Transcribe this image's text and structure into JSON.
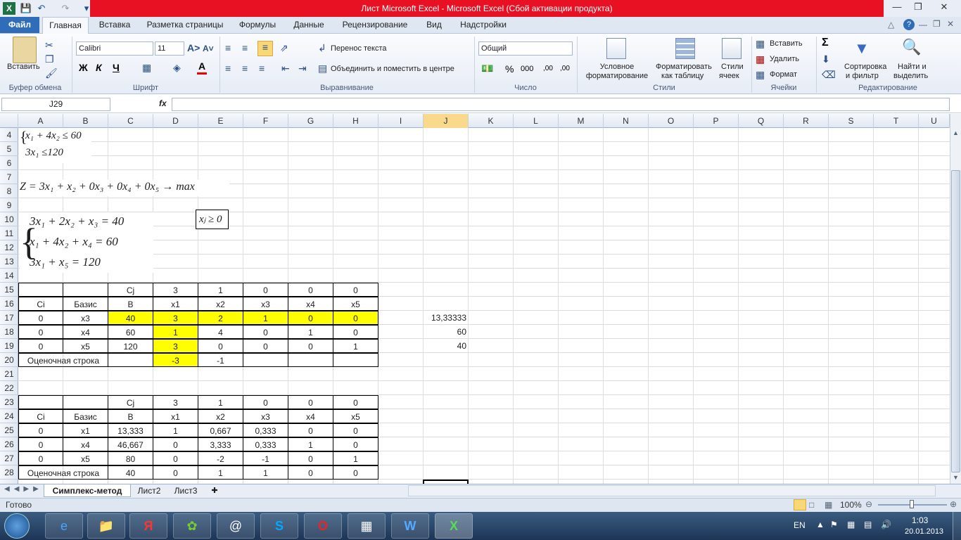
{
  "window": {
    "title": "Лист Microsoft Excel  -  Microsoft Excel (Сбой активации продукта)"
  },
  "tabs": [
    "Файл",
    "Главная",
    "Вставка",
    "Разметка страницы",
    "Формулы",
    "Данные",
    "Рецензирование",
    "Вид",
    "Надстройки"
  ],
  "ribbon": {
    "clipboard": {
      "paste": "Вставить",
      "label": "Буфер обмена"
    },
    "font": {
      "name": "Calibri",
      "size": "11",
      "label": "Шрифт",
      "bold": "Ж",
      "italic": "К",
      "underline": "Ч"
    },
    "alignment": {
      "wrap": "Перенос текста",
      "merge": "Объединить и поместить в центре",
      "label": "Выравнивание"
    },
    "number": {
      "format": "Общий",
      "label": "Число",
      "percent": "%",
      "thousands": "000",
      "inc_decimal": ",00",
      "dec_decimal": ",00"
    },
    "styles": {
      "conditional": "Условное форматирование",
      "conditional_l1": "Условное",
      "conditional_l2": "форматирование",
      "format_table_l1": "Форматировать",
      "format_table_l2": "как таблицу",
      "cell_styles_l1": "Стили",
      "cell_styles_l2": "ячеек",
      "label": "Стили"
    },
    "cells": {
      "insert": "Вставить",
      "delete": "Удалить",
      "format": "Формат",
      "label": "Ячейки"
    },
    "editing": {
      "sort_l1": "Сортировка",
      "sort_l2": "и фильтр",
      "find_l1": "Найти и",
      "find_l2": "выделить",
      "label": "Редактирование",
      "sigma": "Σ"
    }
  },
  "formula_bar": {
    "name_box": "J29",
    "fx": "fx",
    "value": ""
  },
  "columns": [
    "A",
    "B",
    "C",
    "D",
    "E",
    "F",
    "G",
    "H",
    "I",
    "J",
    "K",
    "L",
    "M",
    "N",
    "O",
    "P",
    "Q",
    "R",
    "S",
    "T",
    "U"
  ],
  "rows": [
    "4",
    "5",
    "6",
    "7",
    "8",
    "9",
    "10",
    "11",
    "12",
    "13",
    "14",
    "15",
    "16",
    "17",
    "18",
    "19",
    "20",
    "21",
    "22",
    "23",
    "24",
    "25",
    "26",
    "27",
    "28"
  ],
  "math": {
    "sys1_r1": "x₁ + 4x₂ ≤ 60",
    "sys1_r2": "3x₁ ≤120",
    "objective": "Z = 3x₁ + x₂ + 0x₃ + 0x₄ + 0x₅ → max",
    "sys2_r1": "3x₁ + 2x₂ + x₃ = 40",
    "sys2_r2": "x₁ + 4x₂ + x₄ = 60",
    "sys2_r3": "3x₁ + x₅ = 120",
    "constraint": "xⱼ ≥ 0"
  },
  "table1": {
    "cj_row": [
      "",
      "",
      "Cj",
      "3",
      "1",
      "0",
      "0",
      "0"
    ],
    "header": [
      "Ci",
      "Базис",
      "B",
      "x1",
      "x2",
      "x3",
      "x4",
      "x5"
    ],
    "rows": [
      [
        "0",
        "x3",
        "40",
        "3",
        "2",
        "1",
        "0",
        "0"
      ],
      [
        "0",
        "x4",
        "60",
        "1",
        "4",
        "0",
        "1",
        "0"
      ],
      [
        "0",
        "x5",
        "120",
        "3",
        "0",
        "0",
        "0",
        "1"
      ]
    ],
    "eval_label": "Оценочная строка",
    "eval": [
      "",
      "-3",
      "-1",
      "",
      "",
      ""
    ],
    "ratios": [
      "13,33333",
      "60",
      "40"
    ]
  },
  "table2": {
    "cj_row": [
      "",
      "",
      "Cj",
      "3",
      "1",
      "0",
      "0",
      "0"
    ],
    "header": [
      "Ci",
      "Базис",
      "B",
      "x1",
      "x2",
      "x3",
      "x4",
      "x5"
    ],
    "rows": [
      [
        "0",
        "x1",
        "13,333",
        "1",
        "0,667",
        "0,333",
        "0",
        "0"
      ],
      [
        "0",
        "x4",
        "46,667",
        "0",
        "3,333",
        "0,333",
        "1",
        "0"
      ],
      [
        "0",
        "x5",
        "80",
        "0",
        "-2",
        "-1",
        "0",
        "1"
      ]
    ],
    "eval_label": "Оценочная строка",
    "eval": [
      "40",
      "0",
      "1",
      "1",
      "0",
      "0"
    ]
  },
  "sheets": [
    "Симплекс-метод",
    "Лист2",
    "Лист3"
  ],
  "status": {
    "ready": "Готово",
    "zoom": "100%"
  },
  "taskbar": {
    "lang": "EN",
    "time": "1:03",
    "date": "20.01.2013"
  },
  "colors": {
    "highlight": "#ffff00",
    "title_bar": "#e81123",
    "file_tab": "#2f6db8"
  }
}
